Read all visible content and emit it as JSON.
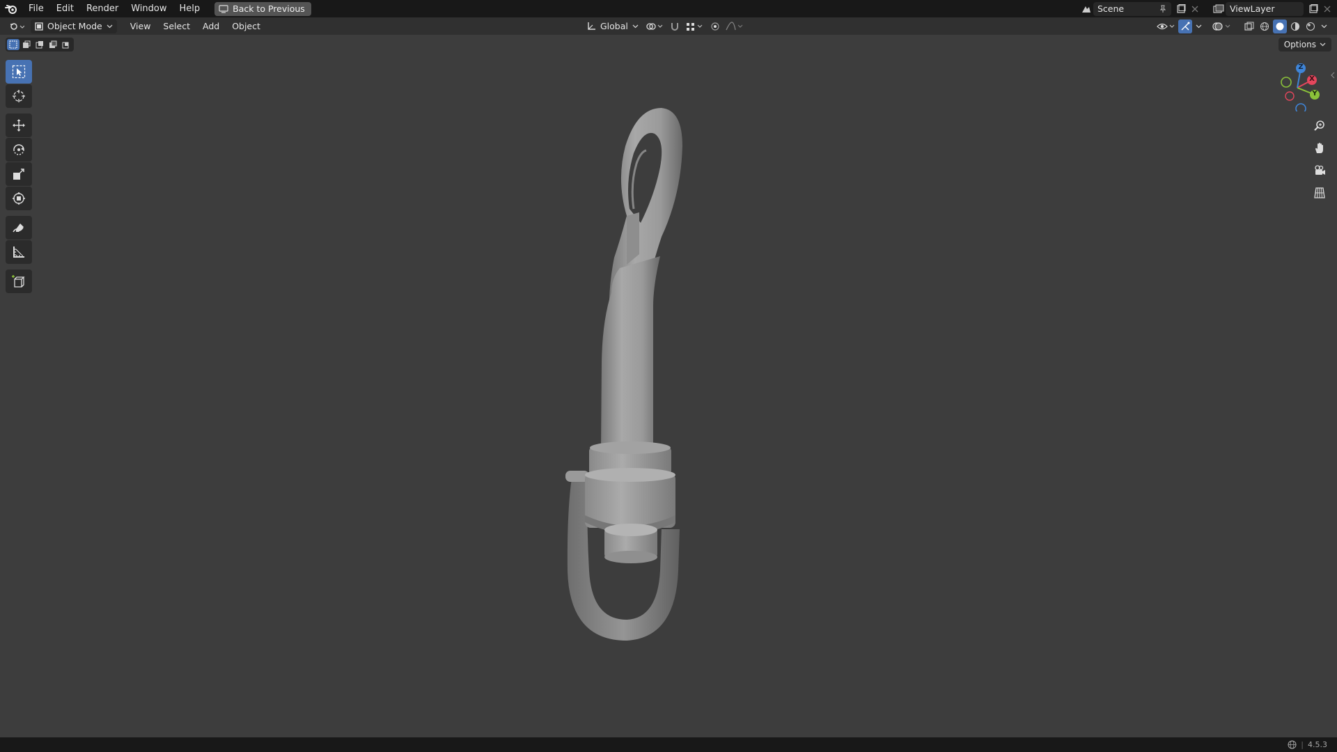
{
  "topbar": {
    "menus": [
      "File",
      "Edit",
      "Render",
      "Window",
      "Help"
    ],
    "back_label": "Back to Previous",
    "scene": "Scene",
    "view_layer": "ViewLayer"
  },
  "header": {
    "mode": "Object Mode",
    "menus": [
      "View",
      "Select",
      "Add",
      "Object"
    ],
    "transform_orientation": "Global"
  },
  "viewport": {
    "options_label": "Options",
    "gizmo": {
      "x": "X",
      "y": "Y",
      "z": "Z"
    }
  },
  "status": {
    "version": "4.5.3"
  },
  "colors": {
    "accent": "#4772b3",
    "axis_x": "#e4465c",
    "axis_y": "#8bc23a",
    "axis_z": "#3f85d8"
  }
}
